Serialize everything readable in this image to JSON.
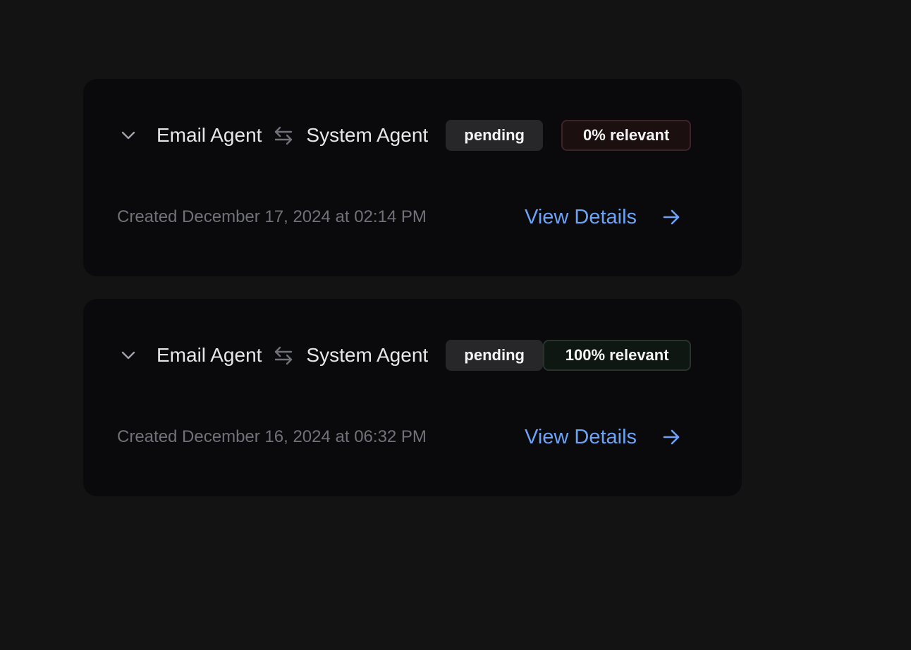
{
  "colors": {
    "page_background": "#131313",
    "card_background": "#0a0a0c",
    "link": "#6aa3f8",
    "muted_text": "#71717a",
    "primary_text": "#e7e7ea",
    "status_badge": "#27272a",
    "low_relevance_badge": "#1b0f10",
    "high_relevance_badge": "#0f1712"
  },
  "icons": {
    "expand": "chevron-down-icon",
    "direction": "arrows-left-right-icon",
    "details": "arrow-right-icon"
  },
  "cards": [
    {
      "from_agent": "Email Agent",
      "to_agent": "System Agent",
      "status": "pending",
      "relevance": "0% relevant",
      "created": "Created December 17, 2024 at 02:14 PM",
      "action_label": "View Details"
    },
    {
      "from_agent": "Email Agent",
      "to_agent": "System Agent",
      "status": "pending",
      "relevance": "100% relevant",
      "created": "Created December 16, 2024 at 06:32 PM",
      "action_label": "View Details"
    }
  ]
}
